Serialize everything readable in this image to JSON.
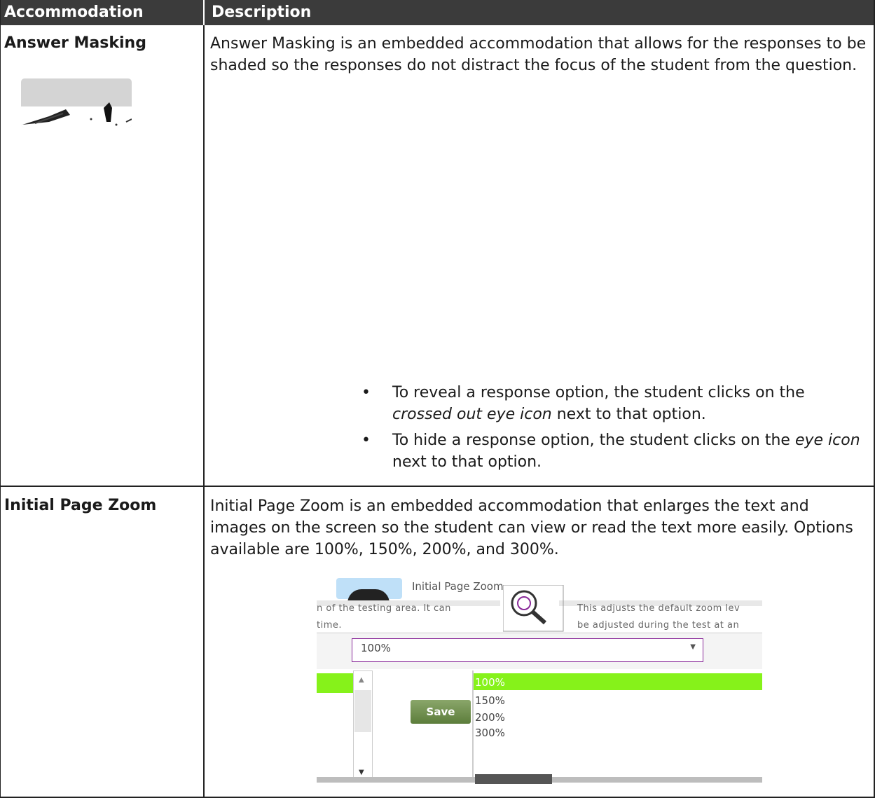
{
  "header": {
    "accommodation": "Accommodation",
    "description": "Description"
  },
  "rows": [
    {
      "label": "Answer Masking",
      "description": "Answer Masking is an embedded accommodation that allows for the responses to be shaded so the responses do not distract the focus of the student from the question.",
      "bullets": [
        {
          "pre": "To reveal a response option, the student clicks on the ",
          "em": "crossed out eye icon",
          "post": " next to that option."
        },
        {
          "pre": "To hide a response option, the student clicks on the ",
          "em": "eye icon",
          "post": " next to that option."
        }
      ]
    },
    {
      "label": "Initial Page Zoom",
      "description": "Initial Page Zoom is an embedded accommodation that enlarges the text and images on the screen so the student can view or read the text more easily. Options available are 100%, 150%, 200%, and 300%."
    }
  ],
  "zoom_screenshot": {
    "title": "Initial Page Zoom",
    "left_text_1": "n of the testing area. It can",
    "left_text_2": "time.",
    "right_text_1": "This adjusts the default zoom lev",
    "right_text_2": "be adjusted during the test at an",
    "selected_value": "100%",
    "options": [
      "100%",
      "150%",
      "200%",
      "300%"
    ],
    "save_label": "Save",
    "colors": {
      "highlight": "#86f21a",
      "select_border": "#8a2a9a",
      "save": "#6b8a48"
    }
  }
}
